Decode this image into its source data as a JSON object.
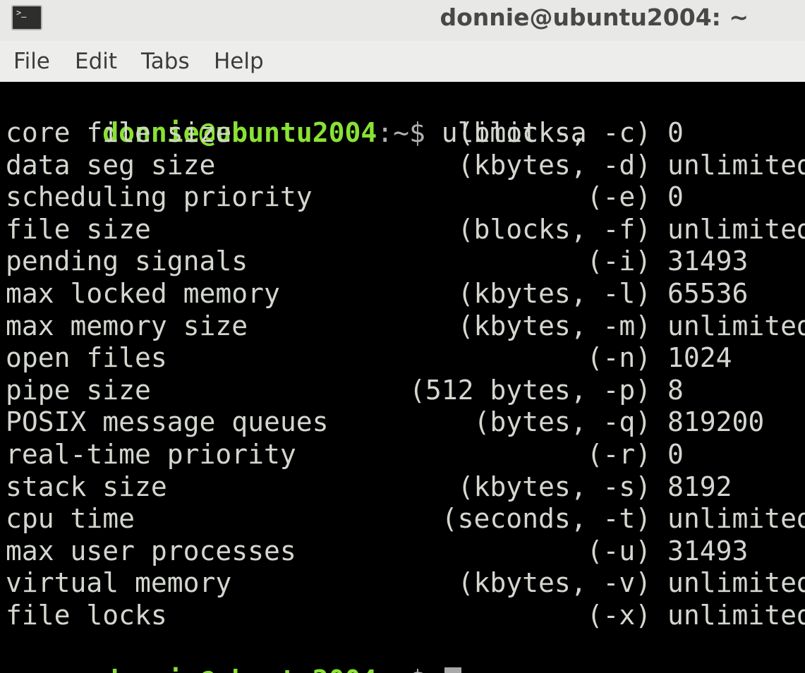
{
  "window": {
    "title": "donnie@ubuntu2004: ~",
    "icon": "terminal-icon",
    "icon_glyph": ">_"
  },
  "menu": {
    "items": [
      {
        "label": "File"
      },
      {
        "label": "Edit"
      },
      {
        "label": "Tabs"
      },
      {
        "label": "Help"
      }
    ]
  },
  "colors": {
    "background": "#000000",
    "prompt_user": "#8ae234",
    "text": "#d3d7cf",
    "titlebar": "#e8e8e7"
  },
  "terminal": {
    "prompt": {
      "user_host": "donnie@ubuntu2004",
      "path_symbol": ":~$ "
    },
    "command": "ulimit -a",
    "limits": [
      {
        "name": "core file size",
        "unit": "(blocks, -c)",
        "value": "0"
      },
      {
        "name": "data seg size",
        "unit": "(kbytes, -d)",
        "value": "unlimited"
      },
      {
        "name": "scheduling priority",
        "unit": "(-e)",
        "value": "0"
      },
      {
        "name": "file size",
        "unit": "(blocks, -f)",
        "value": "unlimited"
      },
      {
        "name": "pending signals",
        "unit": "(-i)",
        "value": "31493"
      },
      {
        "name": "max locked memory",
        "unit": "(kbytes, -l)",
        "value": "65536"
      },
      {
        "name": "max memory size",
        "unit": "(kbytes, -m)",
        "value": "unlimited"
      },
      {
        "name": "open files",
        "unit": "(-n)",
        "value": "1024"
      },
      {
        "name": "pipe size",
        "unit": "(512 bytes, -p)",
        "value": "8"
      },
      {
        "name": "POSIX message queues",
        "unit": "(bytes, -q)",
        "value": "819200"
      },
      {
        "name": "real-time priority",
        "unit": "(-r)",
        "value": "0"
      },
      {
        "name": "stack size",
        "unit": "(kbytes, -s)",
        "value": "8192"
      },
      {
        "name": "cpu time",
        "unit": "(seconds, -t)",
        "value": "unlimited"
      },
      {
        "name": "max user processes",
        "unit": "(-u)",
        "value": "31493"
      },
      {
        "name": "virtual memory",
        "unit": "(kbytes, -v)",
        "value": "unlimited"
      },
      {
        "name": "file locks",
        "unit": "(-x)",
        "value": "unlimited"
      }
    ]
  }
}
